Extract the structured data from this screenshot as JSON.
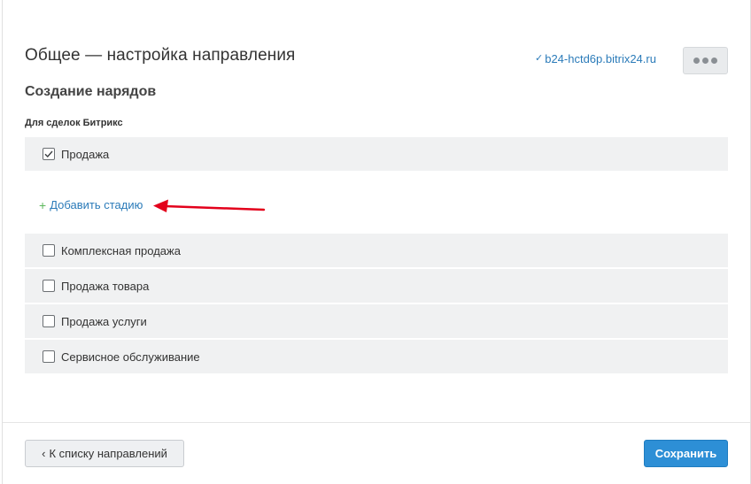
{
  "header": {
    "title": "Общее — настройка направления",
    "domain_link": "b24-hctd6p.bitrix24.ru",
    "domain_icon": "check-icon",
    "more_icon": "more-dots-icon"
  },
  "section": {
    "title": "Создание нарядов",
    "group_title": "Для сделок Битрикс"
  },
  "stages": {
    "first": {
      "label": "Продажа",
      "checked": true
    },
    "add_stage": {
      "label": "Добавить стадию",
      "icon": "plus-icon"
    },
    "items": [
      {
        "label": "Комплексная продажа",
        "checked": false
      },
      {
        "label": "Продажа товара",
        "checked": false
      },
      {
        "label": "Продажа услуги",
        "checked": false
      },
      {
        "label": "Сервисное обслуживание",
        "checked": false
      }
    ]
  },
  "annotation": {
    "arrow_color": "#e3001b"
  },
  "footer": {
    "back_label": "К списку направлений",
    "back_icon": "chevron-left-icon",
    "save_label": "Сохранить"
  },
  "colors": {
    "accent": "#2d8fd6",
    "link": "#2b7bb9",
    "row_bg": "#f0f1f2",
    "add_plus": "#5cb85c"
  }
}
